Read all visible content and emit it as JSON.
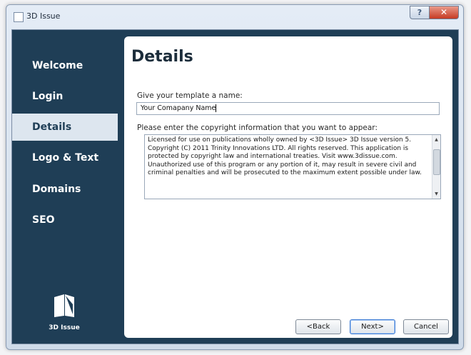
{
  "window": {
    "title": "3D Issue",
    "help_glyph": "?",
    "close_glyph": "✕"
  },
  "sidebar": {
    "items": [
      {
        "label": "Welcome",
        "active": false
      },
      {
        "label": "Login",
        "active": false
      },
      {
        "label": "Details",
        "active": true
      },
      {
        "label": "Logo & Text",
        "active": false
      },
      {
        "label": "Domains",
        "active": false
      },
      {
        "label": "SEO",
        "active": false
      }
    ],
    "brand_text": "3D Issue"
  },
  "main": {
    "title": "Details",
    "name_label": "Give your template a name:",
    "name_value": "Your Comapany Name",
    "copyright_label": "Please enter the copyright information that you want to appear:",
    "copyright_text": "Licensed for use on publications wholly owned by <3D Issue> 3D Issue version 5. Copyright (C) 2011 Trinity Innovations LTD.  All rights reserved. This application is protected by copyright law and international treaties. Visit www.3dissue.com. Unauthorized use of this program or any portion of it, may result in severe civil and criminal penalties and will be prosecuted to the maximum extent possible under law."
  },
  "buttons": {
    "back": "<Back",
    "next": "Next>",
    "cancel": "Cancel"
  },
  "colors": {
    "sidebar_bg": "#1f3e56",
    "active_item_bg": "#dde6ef",
    "close_red": "#c63b23"
  }
}
